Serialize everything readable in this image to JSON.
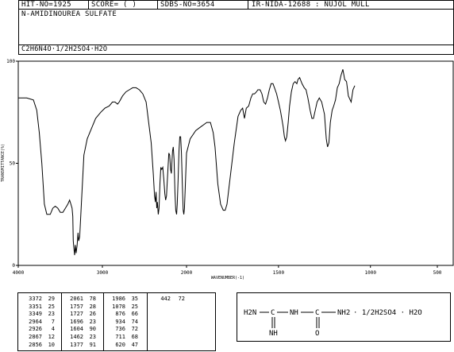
{
  "header": {
    "hit_no": "HIT-NO=1925",
    "score": "SCORE=  (   )",
    "sdbs_no": "SDBS-NO=3654",
    "ir_id": "IR-NIDA-12688 : NUJOL MULL",
    "compound_name": "N-AMIDINOUREA SULFATE",
    "formula": "C2H6N4O·1/2H2SO4·H2O"
  },
  "chart_data": {
    "type": "line",
    "xlabel": "WAVENUMBER(-1)",
    "ylabel": "TRANSMITTANCE(%)",
    "xlim": [
      4000,
      550
    ],
    "ylim": [
      0,
      100
    ],
    "x_ticks": [
      "4000",
      "3000",
      "2000",
      "1500",
      "1000",
      "500"
    ],
    "y_ticks": [
      "0",
      "50",
      "100"
    ],
    "series": [
      {
        "points": [
          [
            4000,
            82
          ],
          [
            3900,
            82
          ],
          [
            3820,
            81
          ],
          [
            3780,
            76
          ],
          [
            3750,
            65
          ],
          [
            3720,
            50
          ],
          [
            3690,
            30
          ],
          [
            3660,
            25
          ],
          [
            3620,
            25
          ],
          [
            3590,
            28
          ],
          [
            3560,
            29
          ],
          [
            3530,
            28
          ],
          [
            3500,
            26
          ],
          [
            3470,
            26
          ],
          [
            3440,
            28
          ],
          [
            3410,
            30
          ],
          [
            3390,
            32
          ],
          [
            3375,
            30
          ],
          [
            3360,
            28
          ],
          [
            3352,
            24
          ],
          [
            3346,
            12
          ],
          [
            3338,
            8
          ],
          [
            3330,
            5
          ],
          [
            3322,
            10
          ],
          [
            3312,
            6
          ],
          [
            3300,
            10
          ],
          [
            3290,
            16
          ],
          [
            3282,
            12
          ],
          [
            3270,
            14
          ],
          [
            3250,
            30
          ],
          [
            3220,
            54
          ],
          [
            3180,
            62
          ],
          [
            3130,
            67
          ],
          [
            3080,
            72
          ],
          [
            3020,
            75
          ],
          [
            2970,
            77
          ],
          [
            2920,
            78
          ],
          [
            2880,
            80
          ],
          [
            2850,
            80
          ],
          [
            2820,
            79
          ],
          [
            2800,
            80
          ],
          [
            2760,
            83
          ],
          [
            2720,
            85
          ],
          [
            2680,
            86
          ],
          [
            2640,
            87
          ],
          [
            2600,
            87
          ],
          [
            2560,
            86
          ],
          [
            2520,
            84
          ],
          [
            2480,
            80
          ],
          [
            2450,
            70
          ],
          [
            2420,
            60
          ],
          [
            2395,
            45
          ],
          [
            2380,
            34
          ],
          [
            2370,
            31
          ],
          [
            2362,
            36
          ],
          [
            2354,
            28
          ],
          [
            2346,
            31
          ],
          [
            2336,
            25
          ],
          [
            2326,
            28
          ],
          [
            2316,
            40
          ],
          [
            2306,
            48
          ],
          [
            2294,
            47
          ],
          [
            2282,
            48
          ],
          [
            2270,
            42
          ],
          [
            2258,
            35
          ],
          [
            2248,
            32
          ],
          [
            2238,
            34
          ],
          [
            2230,
            40
          ],
          [
            2220,
            48
          ],
          [
            2210,
            55
          ],
          [
            2200,
            54
          ],
          [
            2190,
            47
          ],
          [
            2180,
            45
          ],
          [
            2172,
            52
          ],
          [
            2166,
            56
          ],
          [
            2158,
            58
          ],
          [
            2148,
            52
          ],
          [
            2138,
            36
          ],
          [
            2128,
            27
          ],
          [
            2118,
            25
          ],
          [
            2110,
            30
          ],
          [
            2100,
            42
          ],
          [
            2090,
            56
          ],
          [
            2080,
            63
          ],
          [
            2070,
            63
          ],
          [
            2060,
            55
          ],
          [
            2050,
            40
          ],
          [
            2040,
            27
          ],
          [
            2032,
            25
          ],
          [
            2025,
            28
          ],
          [
            2015,
            38
          ],
          [
            2000,
            55
          ],
          [
            1980,
            62
          ],
          [
            1950,
            66
          ],
          [
            1920,
            68
          ],
          [
            1890,
            70
          ],
          [
            1870,
            70
          ],
          [
            1855,
            65
          ],
          [
            1845,
            58
          ],
          [
            1830,
            40
          ],
          [
            1815,
            30
          ],
          [
            1800,
            27
          ],
          [
            1790,
            27
          ],
          [
            1780,
            30
          ],
          [
            1760,
            45
          ],
          [
            1740,
            60
          ],
          [
            1720,
            73
          ],
          [
            1705,
            76
          ],
          [
            1695,
            77
          ],
          [
            1685,
            72
          ],
          [
            1675,
            77
          ],
          [
            1662,
            78
          ],
          [
            1650,
            82
          ],
          [
            1640,
            84
          ],
          [
            1630,
            84
          ],
          [
            1620,
            85
          ],
          [
            1612,
            86
          ],
          [
            1600,
            86
          ],
          [
            1590,
            84
          ],
          [
            1580,
            80
          ],
          [
            1570,
            79
          ],
          [
            1560,
            82
          ],
          [
            1550,
            86
          ],
          [
            1540,
            89
          ],
          [
            1530,
            89
          ],
          [
            1522,
            87
          ],
          [
            1510,
            84
          ],
          [
            1500,
            80
          ],
          [
            1490,
            76
          ],
          [
            1482,
            72
          ],
          [
            1475,
            68
          ],
          [
            1468,
            63
          ],
          [
            1462,
            61
          ],
          [
            1455,
            63
          ],
          [
            1447,
            70
          ],
          [
            1440,
            78
          ],
          [
            1430,
            85
          ],
          [
            1420,
            89
          ],
          [
            1410,
            90
          ],
          [
            1400,
            89
          ],
          [
            1394,
            91
          ],
          [
            1385,
            92
          ],
          [
            1372,
            89
          ],
          [
            1360,
            87
          ],
          [
            1350,
            86
          ],
          [
            1340,
            82
          ],
          [
            1328,
            76
          ],
          [
            1318,
            72
          ],
          [
            1310,
            72
          ],
          [
            1300,
            76
          ],
          [
            1290,
            80
          ],
          [
            1278,
            82
          ],
          [
            1265,
            80
          ],
          [
            1250,
            74
          ],
          [
            1240,
            62
          ],
          [
            1233,
            58
          ],
          [
            1226,
            60
          ],
          [
            1218,
            70
          ],
          [
            1208,
            76
          ],
          [
            1200,
            78
          ],
          [
            1190,
            81
          ],
          [
            1180,
            87
          ],
          [
            1170,
            89
          ],
          [
            1160,
            93
          ],
          [
            1150,
            96
          ],
          [
            1140,
            91
          ],
          [
            1130,
            90
          ],
          [
            1120,
            83
          ],
          [
            1105,
            80
          ],
          [
            1095,
            86
          ],
          [
            1085,
            88
          ]
        ]
      }
    ]
  },
  "peak_table": {
    "col1": [
      "3372",
      "3351",
      "3349",
      "2964",
      "2926",
      "2867",
      "2856"
    ],
    "col2": [
      "29",
      "25",
      "23",
      "7",
      "4",
      "12",
      "10"
    ],
    "col3": [
      "2061",
      "1757",
      "1727",
      "1696",
      "1604",
      "1462",
      "1377"
    ],
    "col4": [
      "78",
      "28",
      "26",
      "23",
      "90",
      "23",
      "91"
    ],
    "col5": [
      "1986",
      "1078",
      "876",
      "934",
      "736",
      "711",
      "620"
    ],
    "col6": [
      "35",
      "25",
      "66",
      "74",
      "72",
      "68",
      "47"
    ],
    "col7": [
      "442"
    ],
    "col8": [
      "72"
    ]
  },
  "structure": {
    "h2n": "H2N",
    "c1": "C",
    "nh": "NH",
    "c2": "C",
    "nh2": "NH2",
    "salt": "· 1/2H2SO4 · H2O",
    "nh_bottom": "NH",
    "o_bottom": "O"
  }
}
